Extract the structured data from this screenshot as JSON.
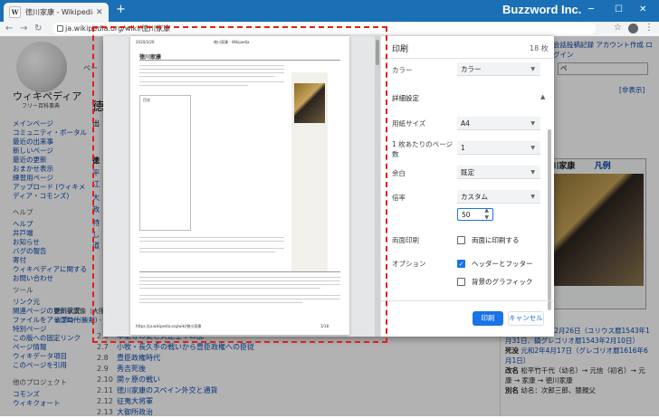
{
  "browser": {
    "tab_title": "徳川家康 - Wikipedia",
    "tab_favicon": "W",
    "brand": "Buzzword Inc.",
    "url": "ja.wikipedia.org/wiki/徳川家康",
    "window_controls": [
      "─",
      "☐",
      "✕"
    ]
  },
  "wiki": {
    "logo_title": "ウィキペディア",
    "logo_sub": "フリー百科事典",
    "nav": [
      "メインページ",
      "コミュニティ・ポータル",
      "最近の出来事",
      "新しいページ",
      "最近の更新",
      "おまかせ表示",
      "練習用ページ",
      "アップロード (ウィキメディア・コモンズ)"
    ],
    "help_heading": "ヘルプ",
    "help": [
      "ヘルプ",
      "井戸端",
      "お知らせ",
      "バグの報告",
      "寄付",
      "ウィキペディアに関するお問い合わせ"
    ],
    "tools_heading": "ツール",
    "tools": [
      "リンク元",
      "関連ページの更新状況",
      "ファイルをアップロード",
      "特別ページ",
      "この版への固定リンク",
      "ページ情報",
      "ウィキデータ項目",
      "このページを引用"
    ],
    "other_heading": "他のプロジェクト",
    "other": [
      "コモンズ",
      "ウィキクォート"
    ],
    "toc": [
      {
        "n": "2.6",
        "t": "本能寺の変と天正壬午の乱"
      },
      {
        "n": "2.7",
        "t": "小牧・長久手の戦いから豊臣政権への臣従"
      },
      {
        "n": "2.8",
        "t": "豊臣政権時代"
      },
      {
        "n": "2.9",
        "t": "秀吉死後"
      },
      {
        "n": "2.10",
        "t": "関ヶ原の戦い"
      },
      {
        "n": "2.11",
        "t": "徳川家康のスペイン外交と通貨"
      },
      {
        "n": "2.12",
        "t": "征夷大将軍"
      },
      {
        "n": "2.13",
        "t": "大御所政治"
      }
    ],
    "top_right": [
      "会話",
      "投稿記録",
      "アカウント作成",
      "ログイン"
    ],
    "search_hint": "ペ",
    "edit_link": "[非表示]",
    "page_fragment": "ペー",
    "left_fragment": [
      "徳",
      "出",
      "徳",
      "平",
      "江",
      "大",
      "政",
      "特",
      "し",
      "道"
    ],
    "infobox_title": "徳川家康",
    "infobox_link": "凡例",
    "infobox_caption": [
      "徳川家康像（大阪城天守閣蔵）",
      "戦国時代(後期) - 江戸時代初期"
    ],
    "infobox_rows": [
      {
        "k": "生誕",
        "v": "天文11年12月26日（ユリウス暦1543年1月31日、鎮グレゴリオ暦1543年2月10日）"
      },
      {
        "k": "死没",
        "v": "元和2年4月17日（グレゴリオ暦1616年6月1日）"
      },
      {
        "k": "改名",
        "v": "松平竹千代（幼名）→ 元信（初名）→ 元康 → 家康 → 徳川家康"
      },
      {
        "k": "別名",
        "v": "幼名：次郎三郎、猿親父"
      }
    ]
  },
  "print": {
    "title": "印刷",
    "sheet_count": "18 枚",
    "color_label": "カラー",
    "color_value": "カラー",
    "details_heading": "詳細設定",
    "paper_label": "用紙サイズ",
    "paper_value": "A4",
    "pps_label": "1 枚あたりのページ数",
    "pps_value": "1",
    "margin_label": "余白",
    "margin_value": "既定",
    "scale_label": "倍率",
    "scale_value": "カスタム",
    "scale_number": "50",
    "duplex_label": "両面印刷",
    "duplex_option": "両面に印刷する",
    "duplex_checked": false,
    "options_label": "オプション",
    "hf_option": "ヘッダーとフッター",
    "hf_checked": true,
    "bg_option": "背景のグラフィック",
    "bg_checked": false,
    "print_button": "印刷",
    "cancel_button": "キャンセル",
    "preview": {
      "date": "2020/2/26",
      "header_title": "徳川家康 - Wikipedia",
      "heading": "徳川家康",
      "toc_label": "目次",
      "footer_url": "https://ja.wikipedia.org/wiki/徳川家康",
      "footer_page": "1/18"
    }
  },
  "colors": {
    "accent": "#1a73e8",
    "tabbar": "#1a6fb5",
    "highlight": "#e0201c"
  }
}
